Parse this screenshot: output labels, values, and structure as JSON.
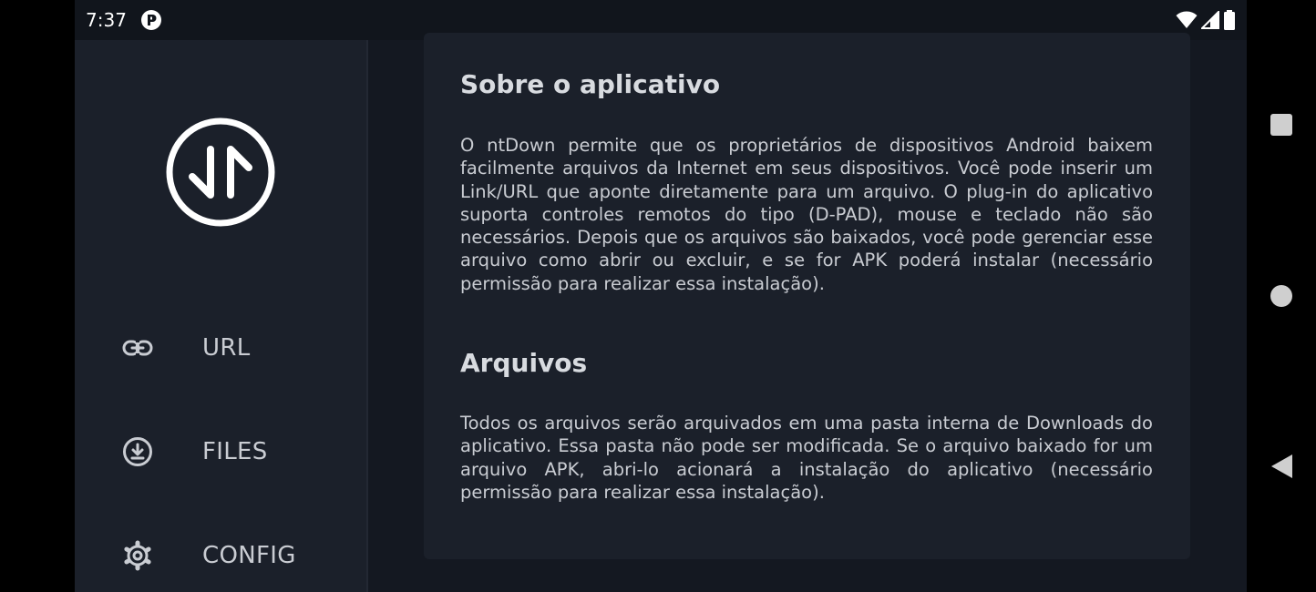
{
  "status_bar": {
    "time": "7:37",
    "app_icon": "notification-app-icon",
    "icons": [
      "wifi-icon",
      "cell-signal-icon",
      "battery-icon"
    ]
  },
  "sidebar": {
    "logo": "up-down-arrows-logo-icon",
    "items": [
      {
        "label": "URL",
        "icon": "link-icon"
      },
      {
        "label": "FILES",
        "icon": "download-circle-icon"
      },
      {
        "label": "CONFIG",
        "icon": "gear-icon"
      }
    ]
  },
  "content": {
    "sections": [
      {
        "title": "Sobre o aplicativo",
        "body": "O ntDown permite que os proprietários de dispositivos Android baixem facilmente arquivos da Internet em seus dispositivos. Você pode inserir um Link/URL que aponte diretamente para um arquivo. O plug-in do aplicativo suporta controles remotos do tipo (D-PAD), mouse e teclado não são necessários. Depois que os arquivos são baixados, você pode gerenciar esse arquivo como abrir ou excluir, e se for APK poderá instalar (necessário permissão para realizar essa instalação)."
      },
      {
        "title": "Arquivos",
        "body": "Todos os arquivos serão arquivados em uma pasta interna de Downloads do aplicativo. Essa pasta não pode ser modificada. Se o arquivo baixado for um arquivo APK, abri-lo acionará a instalação do aplicativo (necessário permissão para realizar essa instalação)."
      }
    ]
  },
  "system_nav": {
    "buttons": [
      "recents-icon",
      "home-icon",
      "back-icon"
    ]
  },
  "colors": {
    "background": "#141821",
    "sidebar": "#1b202a",
    "card": "#1b202a",
    "text": "#c9ccd2",
    "title": "#d8dbe0"
  }
}
